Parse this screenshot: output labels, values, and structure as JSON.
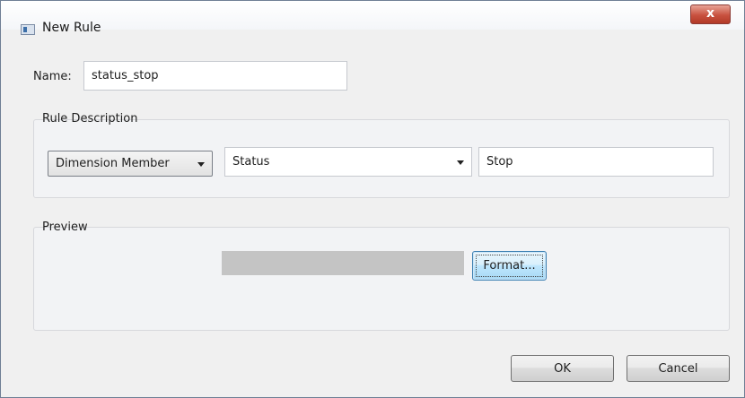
{
  "window": {
    "title": "New Rule",
    "close_glyph": "x"
  },
  "name_field": {
    "label": "Name:",
    "value": "status_stop"
  },
  "rule_description": {
    "title": "Rule Description",
    "type_dropdown": {
      "selected": "Dimension Member"
    },
    "dimension_dropdown": {
      "selected": "Status"
    },
    "member_field": {
      "value": "Stop"
    }
  },
  "preview": {
    "title": "Preview",
    "format_button_label": "Format..."
  },
  "buttons": {
    "ok_label": "OK",
    "cancel_label": "Cancel"
  },
  "colors": {
    "close_button": "#c8513f",
    "preview_swatch": "#c4c4c4",
    "format_button_focus": "#3c7fb1"
  }
}
